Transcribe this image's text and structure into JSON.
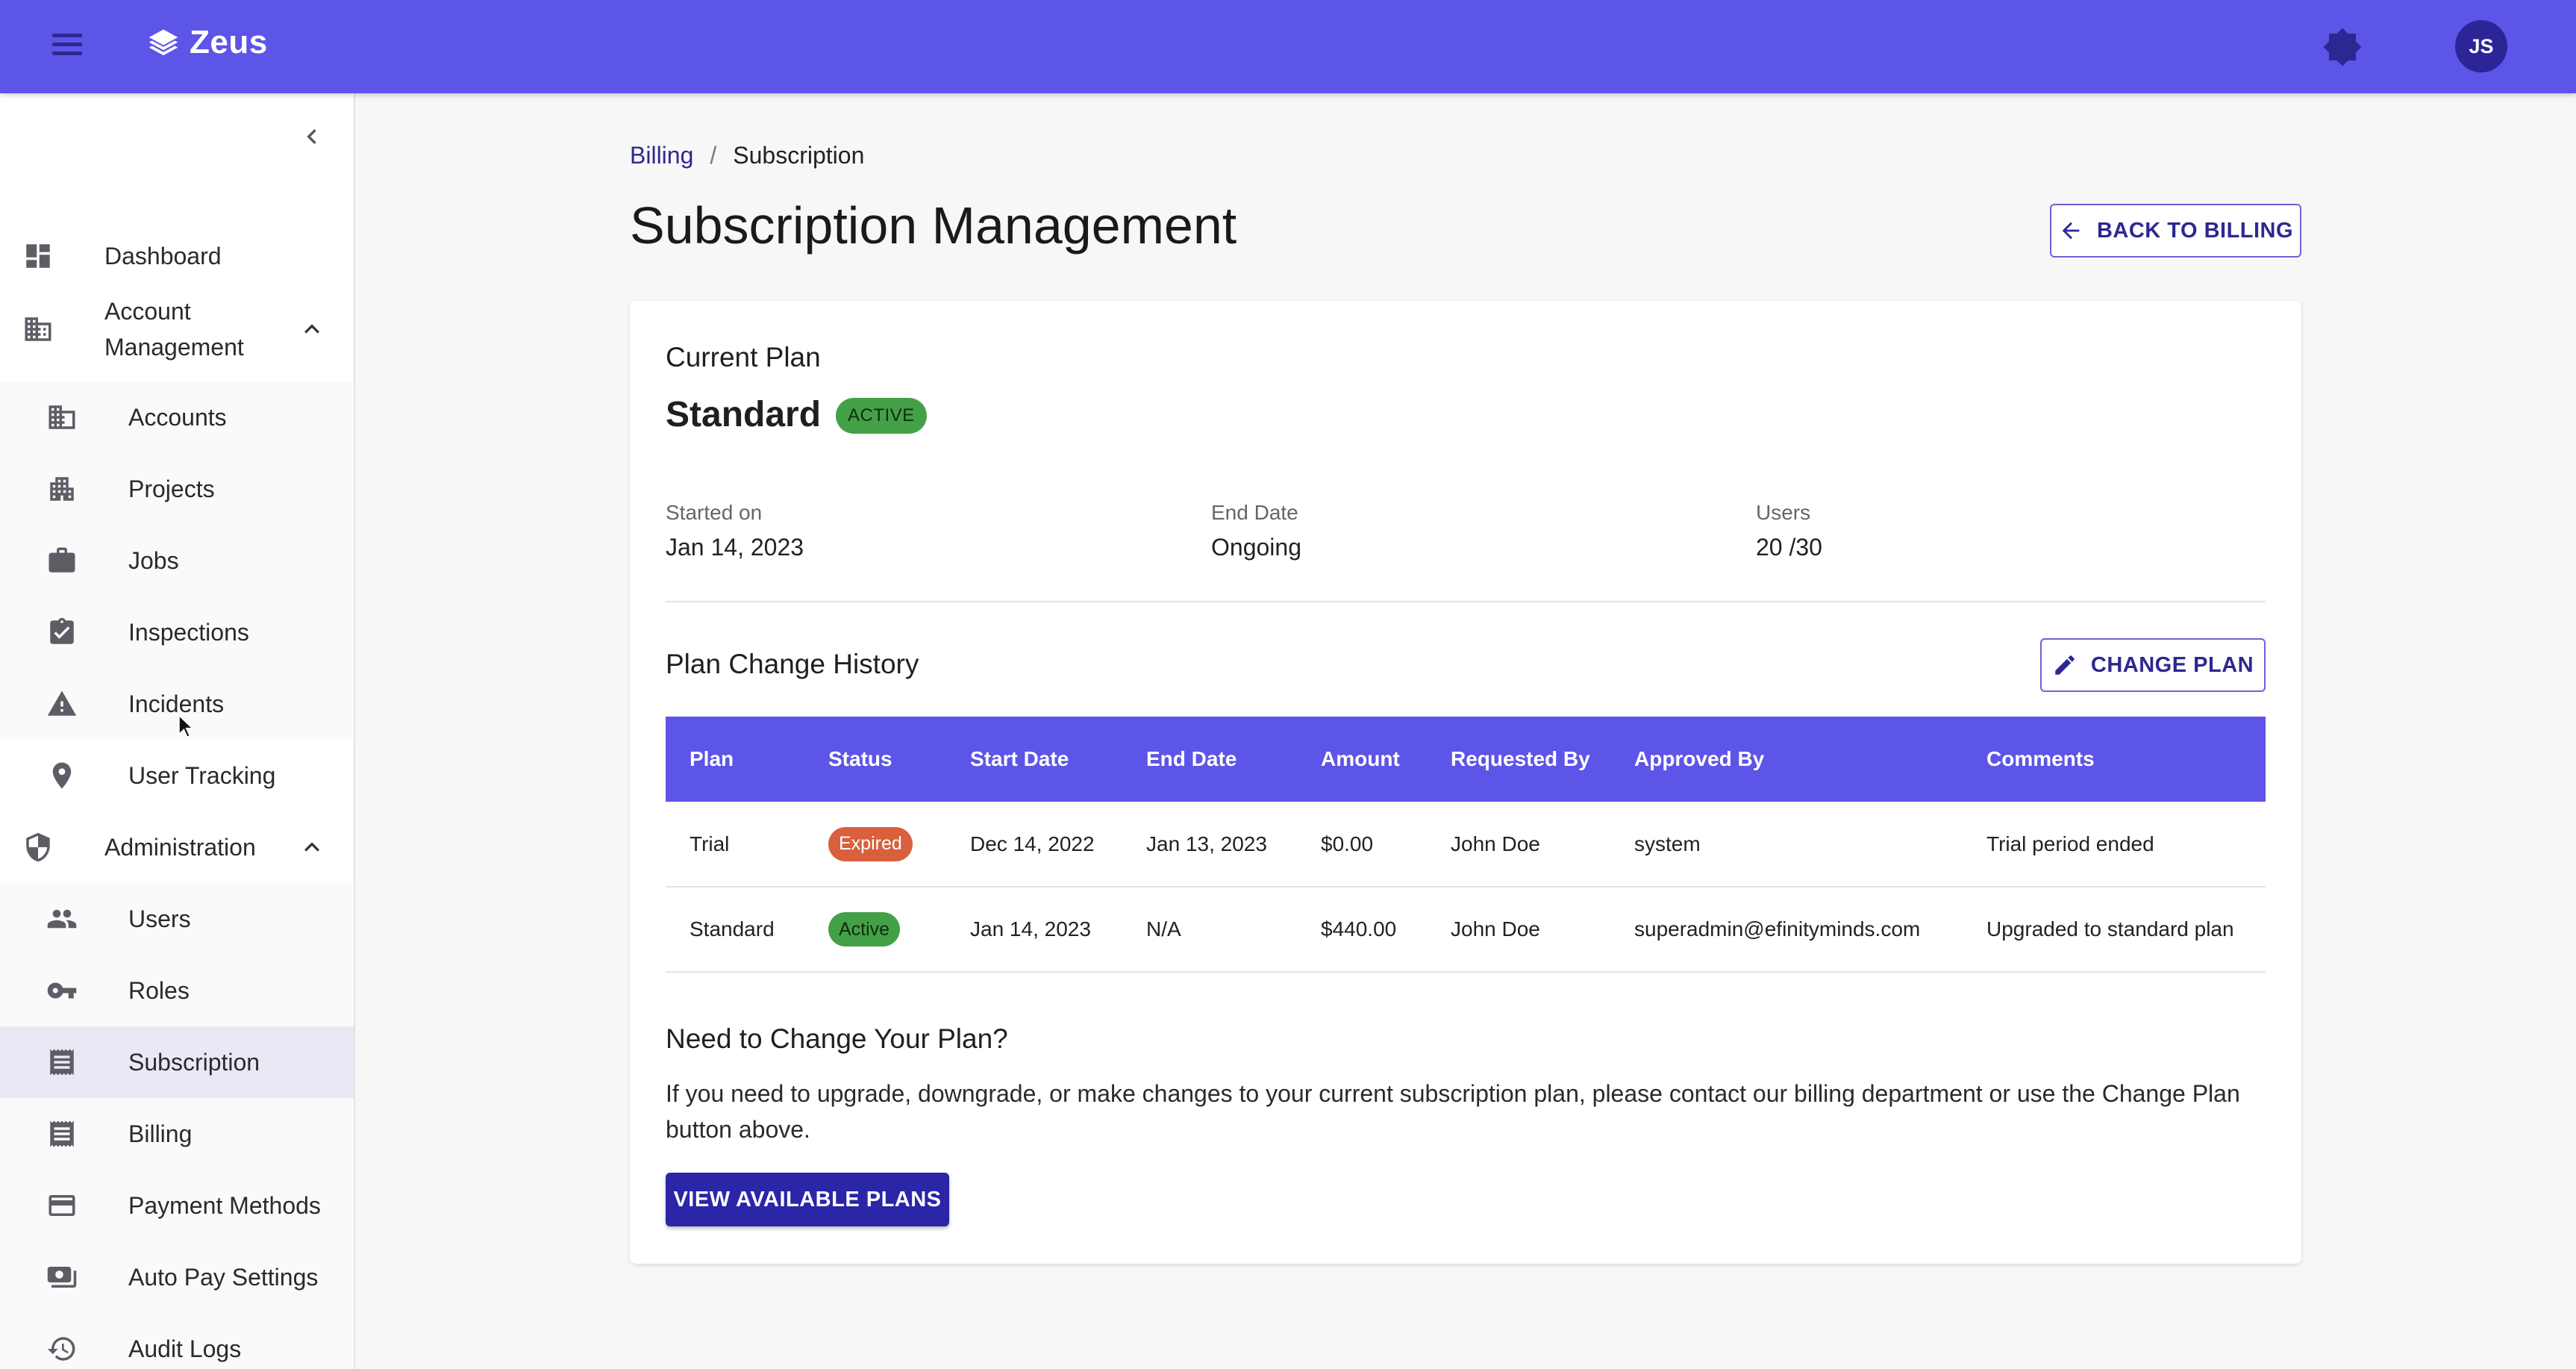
{
  "app": {
    "name": "Zeus",
    "user_initials": "JS"
  },
  "sidebar": {
    "items": [
      {
        "label": "Dashboard",
        "icon": "dashboard-icon"
      },
      {
        "label": "Account\nManagement",
        "icon": "building-icon",
        "expanded": true
      },
      {
        "label": "Accounts",
        "icon": "building-icon"
      },
      {
        "label": "Projects",
        "icon": "apartment-icon"
      },
      {
        "label": "Jobs",
        "icon": "briefcase-icon"
      },
      {
        "label": "Inspections",
        "icon": "clipboard-check-icon"
      },
      {
        "label": "Incidents",
        "icon": "warning-icon"
      },
      {
        "label": "User Tracking",
        "icon": "location-pin-icon"
      },
      {
        "label": "Administration",
        "icon": "shield-icon",
        "expanded": true
      },
      {
        "label": "Users",
        "icon": "people-icon"
      },
      {
        "label": "Roles",
        "icon": "key-icon"
      },
      {
        "label": "Subscription",
        "icon": "receipt-icon",
        "active": true
      },
      {
        "label": "Billing",
        "icon": "receipt-icon"
      },
      {
        "label": "Payment Methods",
        "icon": "credit-card-icon"
      },
      {
        "label": "Auto Pay Settings",
        "icon": "payments-icon"
      },
      {
        "label": "Audit Logs",
        "icon": "history-icon"
      }
    ]
  },
  "breadcrumb": {
    "parent": "Billing",
    "separator": "/",
    "current": "Subscription"
  },
  "page": {
    "title": "Subscription Management",
    "back_button": "BACK TO BILLING"
  },
  "current_plan": {
    "heading": "Current Plan",
    "plan": "Standard",
    "status": "ACTIVE",
    "started_label": "Started on",
    "started_value": "Jan 14, 2023",
    "end_label": "End Date",
    "end_value": "Ongoing",
    "users_label": "Users",
    "users_value": "20 /30"
  },
  "history": {
    "heading": "Plan Change History",
    "change_button": "CHANGE PLAN",
    "columns": [
      "Plan",
      "Status",
      "Start Date",
      "End Date",
      "Amount",
      "Requested By",
      "Approved By",
      "Comments"
    ],
    "rows": [
      {
        "plan": "Trial",
        "status": "Expired",
        "start": "Dec 14, 2022",
        "end": "Jan 13, 2023",
        "amount": "$0.00",
        "requested_by": "John Doe",
        "approved_by": "system",
        "comments": "Trial period ended"
      },
      {
        "plan": "Standard",
        "status": "Active",
        "start": "Jan 14, 2023",
        "end": "N/A",
        "amount": "$440.00",
        "requested_by": "John Doe",
        "approved_by": "superadmin@efinityminds.com",
        "comments": "Upgraded to standard plan"
      }
    ]
  },
  "change_info": {
    "heading": "Need to Change Your Plan?",
    "text": "If you need to upgrade, downgrade, or make changes to your current subscription plan, please contact our billing department or use the Change Plan button above.",
    "button": "VIEW AVAILABLE PLANS"
  },
  "colors": {
    "primary": "#5d55e7",
    "primary_dark": "#2b25a8",
    "active_green": "#44a047",
    "expired_orange": "#d9603c"
  }
}
